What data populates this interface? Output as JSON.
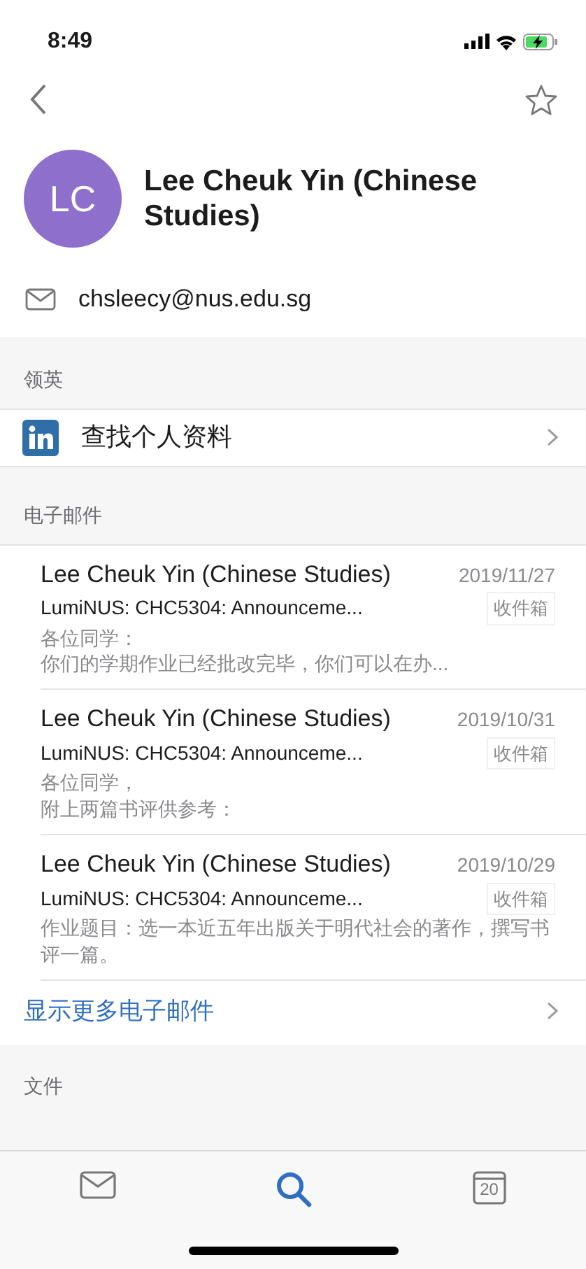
{
  "status_bar": {
    "time": "8:49"
  },
  "contact": {
    "initials": "LC",
    "name": "Lee Cheuk Yin (Chinese Studies)",
    "email": "chsleecy@nus.edu.sg"
  },
  "linkedin": {
    "header": "领英",
    "label": "查找个人资料"
  },
  "emails": {
    "header": "电子邮件",
    "items": [
      {
        "sender": "Lee Cheuk Yin (Chinese Studies)",
        "date": "2019/11/27",
        "subject": "LumiNUS: CHC5304: Announceme...",
        "folder": "收件箱",
        "preview": [
          "各位同学：",
          "你们的学期作业已经批改完毕，你们可以在办..."
        ]
      },
      {
        "sender": "Lee Cheuk Yin (Chinese Studies)",
        "date": "2019/10/31",
        "subject": "LumiNUS: CHC5304: Announceme...",
        "folder": "收件箱",
        "preview": [
          "各位同学，",
          "附上两篇书评供参考："
        ]
      },
      {
        "sender": "Lee Cheuk Yin (Chinese Studies)",
        "date": "2019/10/29",
        "subject": "LumiNUS: CHC5304: Announceme...",
        "folder": "收件箱",
        "preview": [
          "作业题目：选一本近五年出版关于明代社会的著作，撰写书评一篇。"
        ]
      }
    ],
    "more": "显示更多电子邮件"
  },
  "files": {
    "header": "文件"
  },
  "tabs": [
    {
      "kind": "mail",
      "selected": false
    },
    {
      "kind": "search",
      "selected": true
    },
    {
      "kind": "calendar",
      "selected": false,
      "day": "20"
    }
  ]
}
